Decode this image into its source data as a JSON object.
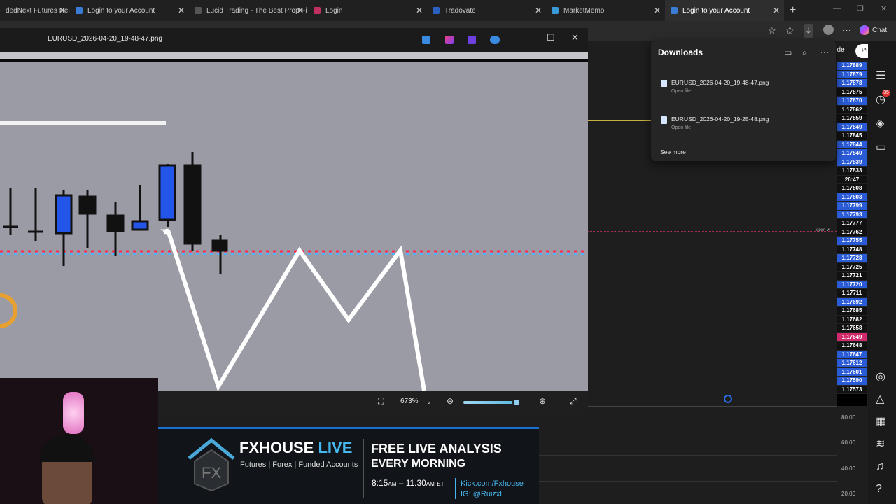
{
  "browser": {
    "tabs": [
      {
        "label": "dedNext Futures Hel",
        "color": "#e0a030"
      },
      {
        "label": "Login to your Account",
        "color": "#3a7bd5"
      },
      {
        "label": "Lucid Trading - The Best Prop Fi",
        "color": "#333333"
      },
      {
        "label": "Login",
        "color": "#c03060"
      },
      {
        "label": "Tradovate",
        "color": "#2a60c0"
      },
      {
        "label": "MarketMemo",
        "color": "#3a9ad9"
      },
      {
        "label": "Login to your Account",
        "color": "#3a7bd5"
      }
    ],
    "new_tab": "+",
    "copilot_label": "Chat"
  },
  "viewer": {
    "filename": "EURUSD_2026-04-20_19-48-47.png",
    "zoom": "673%"
  },
  "downloads": {
    "title": "Downloads",
    "items": [
      {
        "name": "EURUSD_2026-04-20_19-48-47.png",
        "action": "Open file"
      },
      {
        "name": "EURUSD_2026-04-20_19-25-48.png",
        "action": "Open file"
      }
    ],
    "see_more": "See more"
  },
  "tradingview": {
    "publish": "Publish",
    "partial_label": "ude",
    "open_label": "open-w",
    "prices": [
      {
        "v": "1.17889",
        "c": "blue"
      },
      {
        "v": "1.17879",
        "c": "blue"
      },
      {
        "v": "1.17878",
        "c": "blue"
      },
      {
        "v": "1.17875",
        "c": "dark"
      },
      {
        "v": "1.17870",
        "c": "blue"
      },
      {
        "v": "1.17862",
        "c": "dark"
      },
      {
        "v": "1.17859",
        "c": "dark"
      },
      {
        "v": "1.17849",
        "c": "blue"
      },
      {
        "v": "1.17845",
        "c": "dark"
      },
      {
        "v": "1.17844",
        "c": "blue"
      },
      {
        "v": "1.17840",
        "c": "blue"
      },
      {
        "v": "1.17839",
        "c": "blue"
      },
      {
        "v": "1.17833",
        "c": "dark"
      },
      {
        "v": "26:47",
        "c": "dark"
      },
      {
        "v": "1.17808",
        "c": "dark"
      },
      {
        "v": "1.17803",
        "c": "blue"
      },
      {
        "v": "1.17799",
        "c": "blue"
      },
      {
        "v": "1.17793",
        "c": "blue"
      },
      {
        "v": "1.17777",
        "c": "dark"
      },
      {
        "v": "1.17762",
        "c": "dark"
      },
      {
        "v": "1.17755",
        "c": "blue"
      },
      {
        "v": "1.17748",
        "c": "dark"
      },
      {
        "v": "1.17728",
        "c": "blue"
      },
      {
        "v": "1.17725",
        "c": "dark"
      },
      {
        "v": "1.17721",
        "c": "dark"
      },
      {
        "v": "1.17720",
        "c": "blue"
      },
      {
        "v": "1.17711",
        "c": "dark"
      },
      {
        "v": "1.17692",
        "c": "blue"
      },
      {
        "v": "1.17685",
        "c": "dark"
      },
      {
        "v": "1.17682",
        "c": "dark"
      },
      {
        "v": "1.17658",
        "c": "dark"
      },
      {
        "v": "1.17649",
        "c": "pink"
      },
      {
        "v": "1.17648",
        "c": "dark"
      },
      {
        "v": "1.17647",
        "c": "blue"
      },
      {
        "v": "1.17612",
        "c": "blue"
      },
      {
        "v": "1.17601",
        "c": "blue"
      },
      {
        "v": "1.17590",
        "c": "blue"
      },
      {
        "v": "1.17573",
        "c": "dark"
      }
    ],
    "osc_levels": [
      "80.00",
      "60.00",
      "40.00",
      "20.00"
    ],
    "notification_count": "35"
  },
  "banner": {
    "brand": "FXHOUSE",
    "brand_live": "LIVE",
    "tagline": "Futures | Forex | Funded Accounts",
    "headline1": "FREE LIVE ANALYSIS",
    "headline2": "EVERY MORNING",
    "time_start": "8:15",
    "time_start_unit": "AM",
    "time_end": "11.30",
    "time_end_unit": "AM",
    "time_zone": "ET",
    "kick": "Kick.com/Fxhouse",
    "ig": "IG: @Ruizxl"
  }
}
